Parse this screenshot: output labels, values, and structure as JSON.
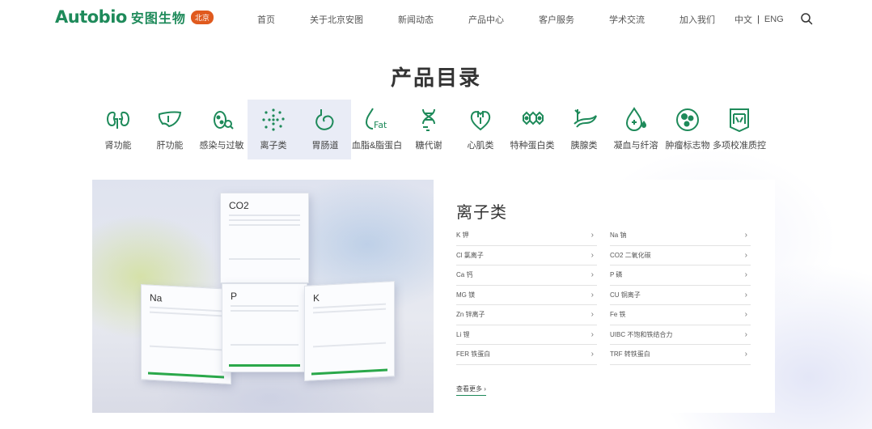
{
  "header": {
    "logo_word": "Autobio",
    "logo_cn": "安图生物",
    "logo_badge": "北京",
    "nav": [
      "首页",
      "关于北京安图",
      "新闻动态",
      "产品中心",
      "客户服务",
      "学术交流",
      "加入我们"
    ],
    "lang_cn": "中文",
    "lang_sep": "|",
    "lang_en": "ENG",
    "search_icon": "search-icon"
  },
  "page_title": "产品目录",
  "categories": [
    {
      "label": "肾功能",
      "icon": "kidney-icon"
    },
    {
      "label": "肝功能",
      "icon": "liver-icon"
    },
    {
      "label": "感染与过敏",
      "icon": "microbe-icon"
    },
    {
      "label": "离子类",
      "icon": "ion-dots-icon",
      "active": true
    },
    {
      "label": "胃肠道",
      "icon": "stomach-icon"
    },
    {
      "label": "血脂&脂蛋白",
      "icon": "fat-drop-icon"
    },
    {
      "label": "糖代谢",
      "icon": "dna-icon"
    },
    {
      "label": "心肌类",
      "icon": "heart-icon"
    },
    {
      "label": "特种蛋白类",
      "icon": "protein-icon"
    },
    {
      "label": "胰腺类",
      "icon": "pancreas-icon"
    },
    {
      "label": "凝血与纤溶",
      "icon": "blood-drop-icon"
    },
    {
      "label": "肿瘤标志物",
      "icon": "cell-icon"
    },
    {
      "label": "多项校准质控",
      "icon": "calibration-icon"
    }
  ],
  "hero": {
    "box_top": "CO2",
    "box_left": "Na",
    "box_mid": "P",
    "box_right": "K"
  },
  "panel": {
    "title": "离子类",
    "items": [
      "K 钾",
      "Na 钠",
      "Cl 氯离子",
      "CO2 二氧化碳",
      "Ca 钙",
      "P 磷",
      "MG 镁",
      "CU 铜离子",
      "Zn 锌离子",
      "Fe 铁",
      "Li 锂",
      "UIBC 不饱和铁结合力",
      "FER 铁蛋白",
      "TRF 转铁蛋白"
    ],
    "more": "查看更多"
  },
  "colors": {
    "brand": "#1e8a5a",
    "badge": "#e05a1e",
    "active_bg": "#e9ecf6"
  }
}
